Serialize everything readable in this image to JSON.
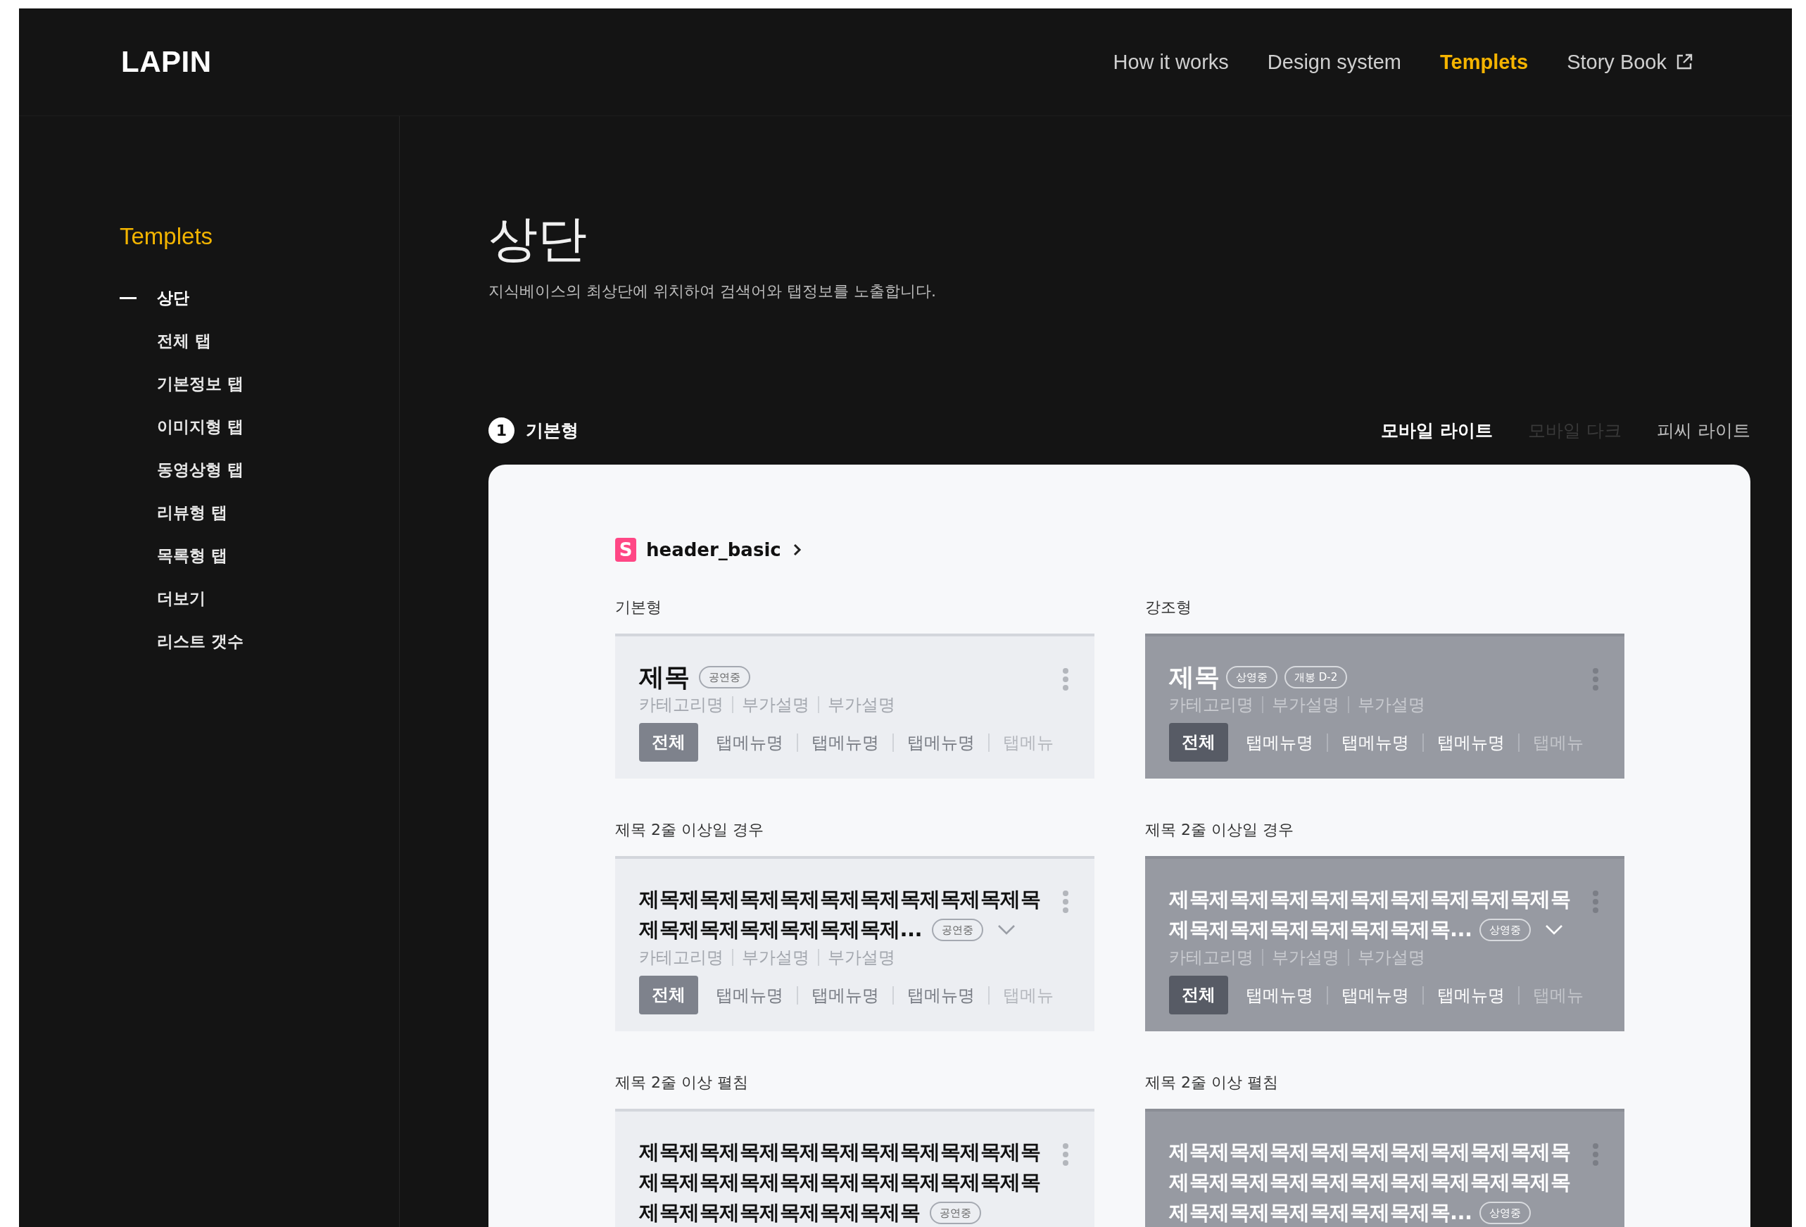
{
  "header": {
    "logo": "LAPIN",
    "nav": [
      {
        "label": "How it works",
        "selected": false,
        "external": false
      },
      {
        "label": "Design system",
        "selected": false,
        "external": false
      },
      {
        "label": "Templets",
        "selected": true,
        "external": false
      },
      {
        "label": "Story Book",
        "selected": false,
        "external": true
      }
    ]
  },
  "sidebar": {
    "title": "Templets",
    "items": [
      {
        "label": "상단",
        "selected": true
      },
      {
        "label": "전체 탭",
        "selected": false
      },
      {
        "label": "기본정보 탭",
        "selected": false
      },
      {
        "label": "이미지형 탭",
        "selected": false
      },
      {
        "label": "동영상형 탭",
        "selected": false
      },
      {
        "label": "리뷰형 탭",
        "selected": false
      },
      {
        "label": "목록형 탭",
        "selected": false
      },
      {
        "label": "더보기",
        "selected": false
      },
      {
        "label": "리스트 갯수",
        "selected": false
      }
    ]
  },
  "page": {
    "title": "상단",
    "description": "지식베이스의 최상단에 위치하여 검색어와 탭정보를 노출합니다."
  },
  "section": {
    "number": "1",
    "title": "기본형",
    "themes": [
      {
        "label": "모바일 라이트",
        "selected": true,
        "disabled": false
      },
      {
        "label": "모바일 다크",
        "selected": false,
        "disabled": true
      },
      {
        "label": "피씨 라이트",
        "selected": false,
        "disabled": false
      }
    ]
  },
  "preview": {
    "logo_letter": "S",
    "component": "header_basic",
    "columns": [
      {
        "title": "기본형",
        "kind": "light",
        "groups": [
          {
            "card": {
              "title_lines": [
                "제목"
              ],
              "badges": [
                "공연중"
              ],
              "expandable": false,
              "meta": [
                "카테고리명",
                "부가설명",
                "부가설명"
              ],
              "tabs": [
                {
                  "label": "전체",
                  "selected": true
                },
                {
                  "label": "탭메뉴명",
                  "selected": false
                },
                {
                  "label": "탭메뉴명",
                  "selected": false
                },
                {
                  "label": "탭메뉴명",
                  "selected": false
                },
                {
                  "label": "탭메뉴",
                  "selected": false
                }
              ]
            }
          },
          {
            "label": "제목 2줄 이상일 경우",
            "card": {
              "title_lines": [
                "제목제목제목제목제목제목제목제목제목제목",
                "제목제목제목제목제목제목제..."
              ],
              "badges": [
                "공연중"
              ],
              "expandable": true,
              "meta": [
                "카테고리명",
                "부가설명",
                "부가설명"
              ],
              "tabs": [
                {
                  "label": "전체",
                  "selected": true
                },
                {
                  "label": "탭메뉴명",
                  "selected": false
                },
                {
                  "label": "탭메뉴명",
                  "selected": false
                },
                {
                  "label": "탭메뉴명",
                  "selected": false
                },
                {
                  "label": "탭메뉴",
                  "selected": false
                }
              ]
            }
          },
          {
            "label": "제목 2줄 이상 펼침",
            "card": {
              "title_lines": [
                "제목제목제목제목제목제목제목제목제목제목",
                "제목제목제목제목제목제목제목제목제목제목",
                "제목제목제목제목제목제목제목"
              ],
              "badges": [
                "공연중"
              ],
              "expandable": false
            }
          }
        ]
      },
      {
        "title": "강조형",
        "kind": "emphasis",
        "groups": [
          {
            "card": {
              "title_lines": [
                "제목"
              ],
              "badges": [
                "상영중",
                "개봉 D-2"
              ],
              "expandable": false,
              "meta": [
                "카테고리명",
                "부가설명",
                "부가설명"
              ],
              "tabs": [
                {
                  "label": "전체",
                  "selected": true
                },
                {
                  "label": "탭메뉴명",
                  "selected": false
                },
                {
                  "label": "탭메뉴명",
                  "selected": false
                },
                {
                  "label": "탭메뉴명",
                  "selected": false
                },
                {
                  "label": "탭메뉴",
                  "selected": false
                }
              ]
            }
          },
          {
            "label": "제목 2줄 이상일 경우",
            "card": {
              "title_lines": [
                "제목제목제목제목제목제목제목제목제목제목",
                "제목제목제목제목제목제목제목..."
              ],
              "badges": [
                "상영중"
              ],
              "expandable": true,
              "meta": [
                "카테고리명",
                "부가설명",
                "부가설명"
              ],
              "tabs": [
                {
                  "label": "전체",
                  "selected": true
                },
                {
                  "label": "탭메뉴명",
                  "selected": false
                },
                {
                  "label": "탭메뉴명",
                  "selected": false
                },
                {
                  "label": "탭메뉴명",
                  "selected": false
                },
                {
                  "label": "탭메뉴",
                  "selected": false
                }
              ]
            }
          },
          {
            "label": "제목 2줄 이상 펼침",
            "card": {
              "title_lines": [
                "제목제목제목제목제목제목제목제목제목제목",
                "제목제목제목제목제목제목제목제목제목제목",
                "제목제목제목제목제목제목제목..."
              ],
              "badges": [
                "상영중"
              ],
              "expandable": false
            }
          }
        ]
      }
    ]
  }
}
